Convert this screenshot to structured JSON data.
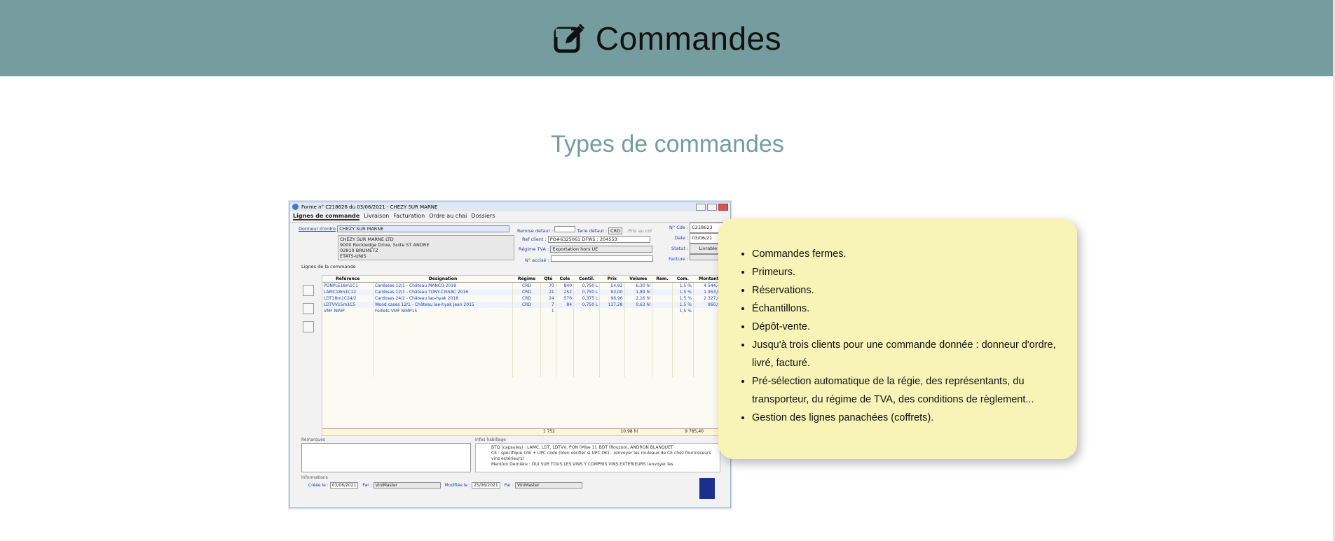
{
  "header": {
    "title": "Commandes",
    "icon": "pencil-square-icon"
  },
  "section": {
    "title": "Types de commandes"
  },
  "screenshot": {
    "window_title": "Forme n° C218628 du 03/06/2021 - CHEZY SUR MARNE",
    "tabs": [
      "Lignes de commande",
      "Livraison",
      "Facturation",
      "Ordre au chai",
      "Dossiers"
    ],
    "donneur_label": "Donneur d'ordre",
    "donneur_value": "CHEZY SUR MARNE",
    "address": [
      "CHEZY SUR MARNE LTD",
      "9000 Rockledge Drive, Suite ST ANDRE",
      "02810 BRUMETZ",
      "ETATS-UNIS"
    ],
    "remise_label": "Remise défaut :",
    "tarie_label": "Tarie défaut :",
    "tarie_value": "CRD",
    "prix_label": "Prix au col",
    "ref_label": "Ref client :",
    "ref_value": "PO#6325061 DFWS : 204553",
    "regime_label": "Régime TVA :",
    "regime_value": "Exportation hors UE",
    "accise_label": "N° accisé :",
    "ncde_label": "N° Cde :",
    "ncde_value": "C218623",
    "date_label": "Date :",
    "date_value": "03/06/21",
    "statut_label": "Statut :",
    "statut_value": "Livrable",
    "facture_label": "Facture :",
    "lines_label": "Lignes de la commande",
    "columns": [
      "Référence",
      "Désignation",
      "Régime",
      "Qté",
      "Cole",
      "Centil.",
      "Prix",
      "Volume",
      "Rem.",
      "Com.",
      "Montant"
    ],
    "rows": [
      [
        "PONPLE18m1C1",
        "Cardoses 12/1 - Château MANCO 2018",
        "CRD",
        "70",
        "840",
        "0,750 L",
        "54,92",
        "6,30 hl",
        "",
        "1,5 %",
        "4 544,40"
      ],
      [
        "LAMC18m1C12",
        "Cardoses 12/1 - Château TONY-CISSAC 2016",
        "CRD",
        "21",
        "252",
        "0,750 L",
        "93,00",
        "1,89 hl",
        "",
        "1,5 %",
        "1 953,00"
      ],
      [
        "LDT18m1C24/2",
        "Cardoses 24/2 - Château lao-hyak 2018",
        "CRD",
        "24",
        "576",
        "0,375 L",
        "96,96",
        "2,16 hl",
        "",
        "1,5 %",
        "2 327,04"
      ],
      [
        "LDTVV15m1C5",
        "Wood cases 12/1 - Château lae-hyak Jean 2015",
        "CRD",
        "7",
        "84",
        "0,750 L",
        "137,28",
        "0,63 hl",
        "",
        "1,5 %",
        "960,96"
      ],
      [
        "VMF NIMP",
        "Feillets VMF NIMP15",
        "",
        "1",
        "",
        "",
        "",
        "",
        "",
        "1,5 %",
        ""
      ]
    ],
    "totals": {
      "cols": "1 752",
      "volume": "10,98 hl",
      "montant": "9 785,40"
    },
    "remarks_label": "Remarques",
    "infos_label": "Infos habillage",
    "infos_lines": [
      "BTQ (capsules) : LAMC, LDT, LDTVV, PON (Mise 1), BDT (Rouzoo), ANDRON BLANQUET",
      "CE : spécifique GW + UPC code (bien vérifier si UPC OK) - (envoyer les rouleaux de CE chez fournisseurs vins extérieurs)",
      "Mention Dernière : OUI SUR TOUS LES VINS Y COMPRIS VINS EXTERIEURS (envoyer les"
    ],
    "info_label": "Informations",
    "cree_label": "Créée le :",
    "cree_value": "03/06/2021",
    "par_label": "Par :",
    "par_value": "ViniMaster",
    "modif_label": "Modifiée le :",
    "modif_value": "25/06/2021",
    "par2_value": "ViniMaster"
  },
  "features": [
    "Commandes fermes.",
    "Primeurs.",
    "Réservations.",
    "Échantillons.",
    "Dépôt-vente.",
    "Jusqu'à trois clients pour une commande donnée : donneur d'ordre, livré, facturé.",
    "Pré-sélection automatique de la régie, des représentants, du transporteur, du régime de TVA, des conditions de règlement...",
    "Gestion des lignes panachées (coffrets)."
  ]
}
